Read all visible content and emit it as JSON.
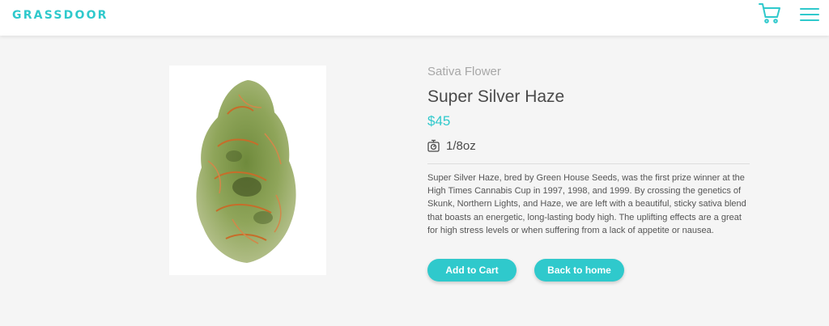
{
  "header": {
    "logo": "GRASSDOOR",
    "cart_icon": "shopping-cart-icon",
    "menu_icon": "hamburger-menu-icon"
  },
  "product": {
    "category": "Sativa Flower",
    "name": "Super Silver Haze",
    "price": "$45",
    "weight_icon": "scale-icon",
    "weight": "1/8oz",
    "description": "Super Silver Haze, bred by Green House Seeds, was the first prize winner at the High Times Cannabis Cup in 1997, 1998, and 1999. By crossing the genetics of Skunk, Northern Lights, and Haze, we are left with a beautiful, sticky sativa blend that boasts an energetic, long-lasting body high. The uplifting effects are a great for high stress levels or when suffering from a lack of appetite or nausea.",
    "add_to_cart_label": "Add to Cart",
    "back_home_label": "Back to home"
  },
  "colors": {
    "accent": "#2fc9cc",
    "background": "#f5f5f5",
    "text": "#4a4a4a",
    "muted": "#a7a7a7"
  }
}
